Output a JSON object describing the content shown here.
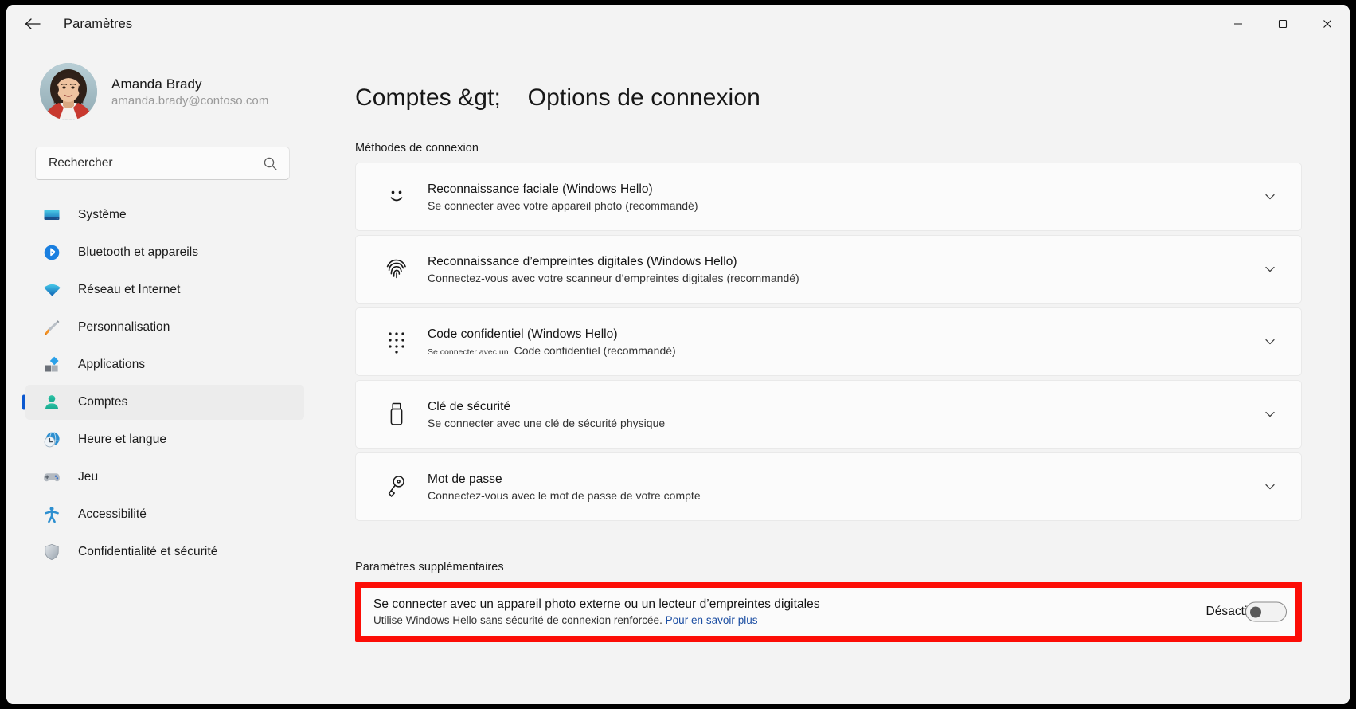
{
  "window": {
    "titlebar_title": "Paramètres",
    "back_icon": "arrow-left-icon",
    "minimize_icon": "minimize-icon",
    "maximize_icon": "maximize-icon",
    "close_icon": "close-icon"
  },
  "sidebar": {
    "profile": {
      "name": "Amanda Brady",
      "email": "amanda.brady@contoso.com",
      "avatar_icon": "user-avatar-photo"
    },
    "search": {
      "placeholder": "Rechercher",
      "value": "Rechercher",
      "icon": "search-icon"
    },
    "items": [
      {
        "label": "Système",
        "icon": "monitor-icon",
        "selected": false
      },
      {
        "label": "Bluetooth et appareils",
        "icon": "bluetooth-icon",
        "selected": false
      },
      {
        "label": "Réseau et Internet",
        "icon": "wifi-icon",
        "selected": false
      },
      {
        "label": "Personnalisation",
        "icon": "paintbrush-icon",
        "selected": false
      },
      {
        "label": "Applications",
        "icon": "apps-icon",
        "selected": false
      },
      {
        "label": "Comptes",
        "icon": "accounts-person-icon",
        "selected": true
      },
      {
        "label": "Heure et langue",
        "icon": "clock-globe-icon",
        "selected": false
      },
      {
        "label": "Jeu",
        "icon": "gamepad-icon",
        "selected": false
      },
      {
        "label": "Accessibilité",
        "icon": "accessibility-person-icon",
        "selected": false
      },
      {
        "label": "Confidentialité et sécurité",
        "icon": "shield-icon",
        "selected": false
      }
    ]
  },
  "main": {
    "page_title": "Comptes &gt;    Options de connexion",
    "sections": {
      "methods_label": "Méthodes de connexion",
      "extra_label": "Paramètres supplémentaires"
    },
    "cards": [
      {
        "title": "Reconnaissance faciale (Windows Hello)",
        "subtitle": "Se connecter avec votre appareil photo (recommandé)",
        "icon": "face-smiley-icon",
        "chevron": "chevron-down-icon"
      },
      {
        "title": "Reconnaissance d’empreintes digitales (Windows Hello)",
        "subtitle": "Connectez-vous avec votre scanneur d’empreintes digitales (recommandé)",
        "icon": "fingerprint-icon",
        "chevron": "chevron-down-icon"
      },
      {
        "title": "Code confidentiel (Windows Hello)",
        "subtitle_small": "Se connecter avec un",
        "subtitle_rest": "Code confidentiel (recommandé)",
        "icon": "pin-dots-icon",
        "chevron": "chevron-down-icon"
      },
      {
        "title": "Clé de sécurité",
        "subtitle": "Se connecter avec une clé de sécurité physique",
        "icon": "security-key-icon",
        "chevron": "chevron-down-icon"
      },
      {
        "title": "Mot de passe",
        "subtitle": "Connectez-vous avec le mot de passe de votre compte",
        "icon": "password-key-icon",
        "chevron": "chevron-down-icon"
      }
    ],
    "highlighted_setting": {
      "title": "Se connecter avec un appareil photo externe ou un lecteur d’empreintes digitales",
      "subtitle_text": "Utilise Windows Hello sans sécurité de connexion renforcée. ",
      "subtitle_link": "Pour en savoir plus",
      "toggle_label": "Désactivé",
      "toggle_state": "off"
    }
  },
  "colors": {
    "accent": "#0b58d0",
    "highlight_border": "#fc0d06",
    "page_background": "#f3f3f3",
    "card_background": "#fbfbfb",
    "link": "#1d4fa3"
  }
}
